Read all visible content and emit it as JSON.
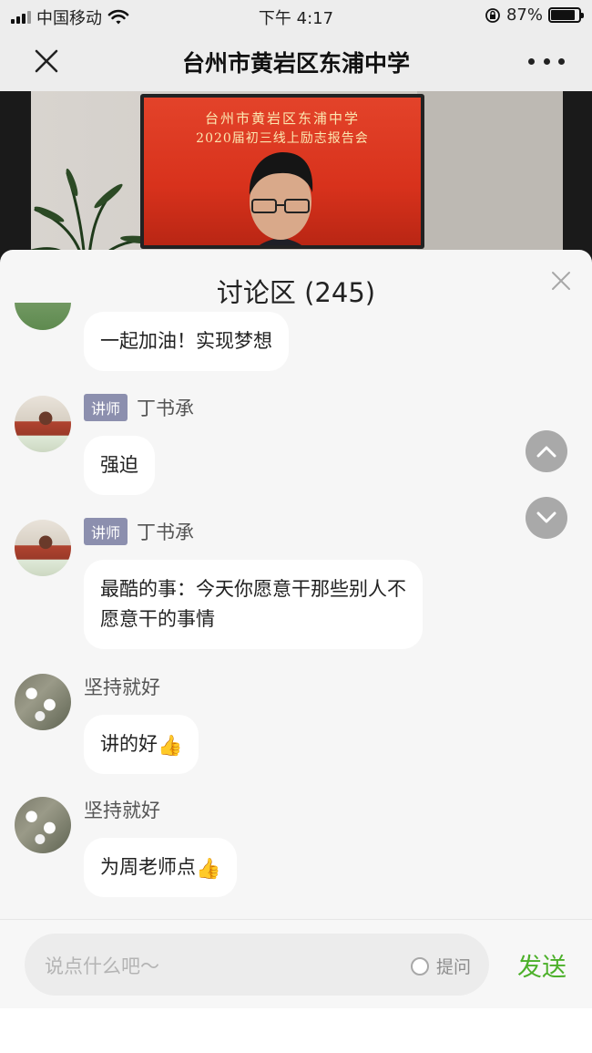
{
  "status_bar": {
    "carrier": "中国移动",
    "time": "下午 4:17",
    "battery": "87%",
    "battery_level": 0.87
  },
  "nav": {
    "title": "台州市黄岩区东浦中学"
  },
  "video": {
    "banner_line1": "台州市黄岩区东浦中学",
    "banner_line2": "2020届初三线上励志报告会"
  },
  "discussion": {
    "title": "讨论区 (245)",
    "messages": [
      {
        "text": "一起加油！实现梦想"
      },
      {
        "badge": "讲师",
        "name": "丁书承",
        "text": "强迫"
      },
      {
        "badge": "讲师",
        "name": "丁书承",
        "line1": "最酷的事：今天你愿意干那些别人不",
        "line2": "愿意干的事情"
      },
      {
        "name": "坚持就好",
        "text": "讲的好",
        "emoji": "👍"
      },
      {
        "name": "坚持就好",
        "text": "为周老师点",
        "emoji": "👍"
      }
    ]
  },
  "input": {
    "placeholder": "说点什么吧～",
    "ask_label": "提问",
    "send_label": "发送"
  },
  "colors": {
    "send": "#4cb02a",
    "badge": "#8c8fae",
    "nav_bg": "#ededed"
  }
}
